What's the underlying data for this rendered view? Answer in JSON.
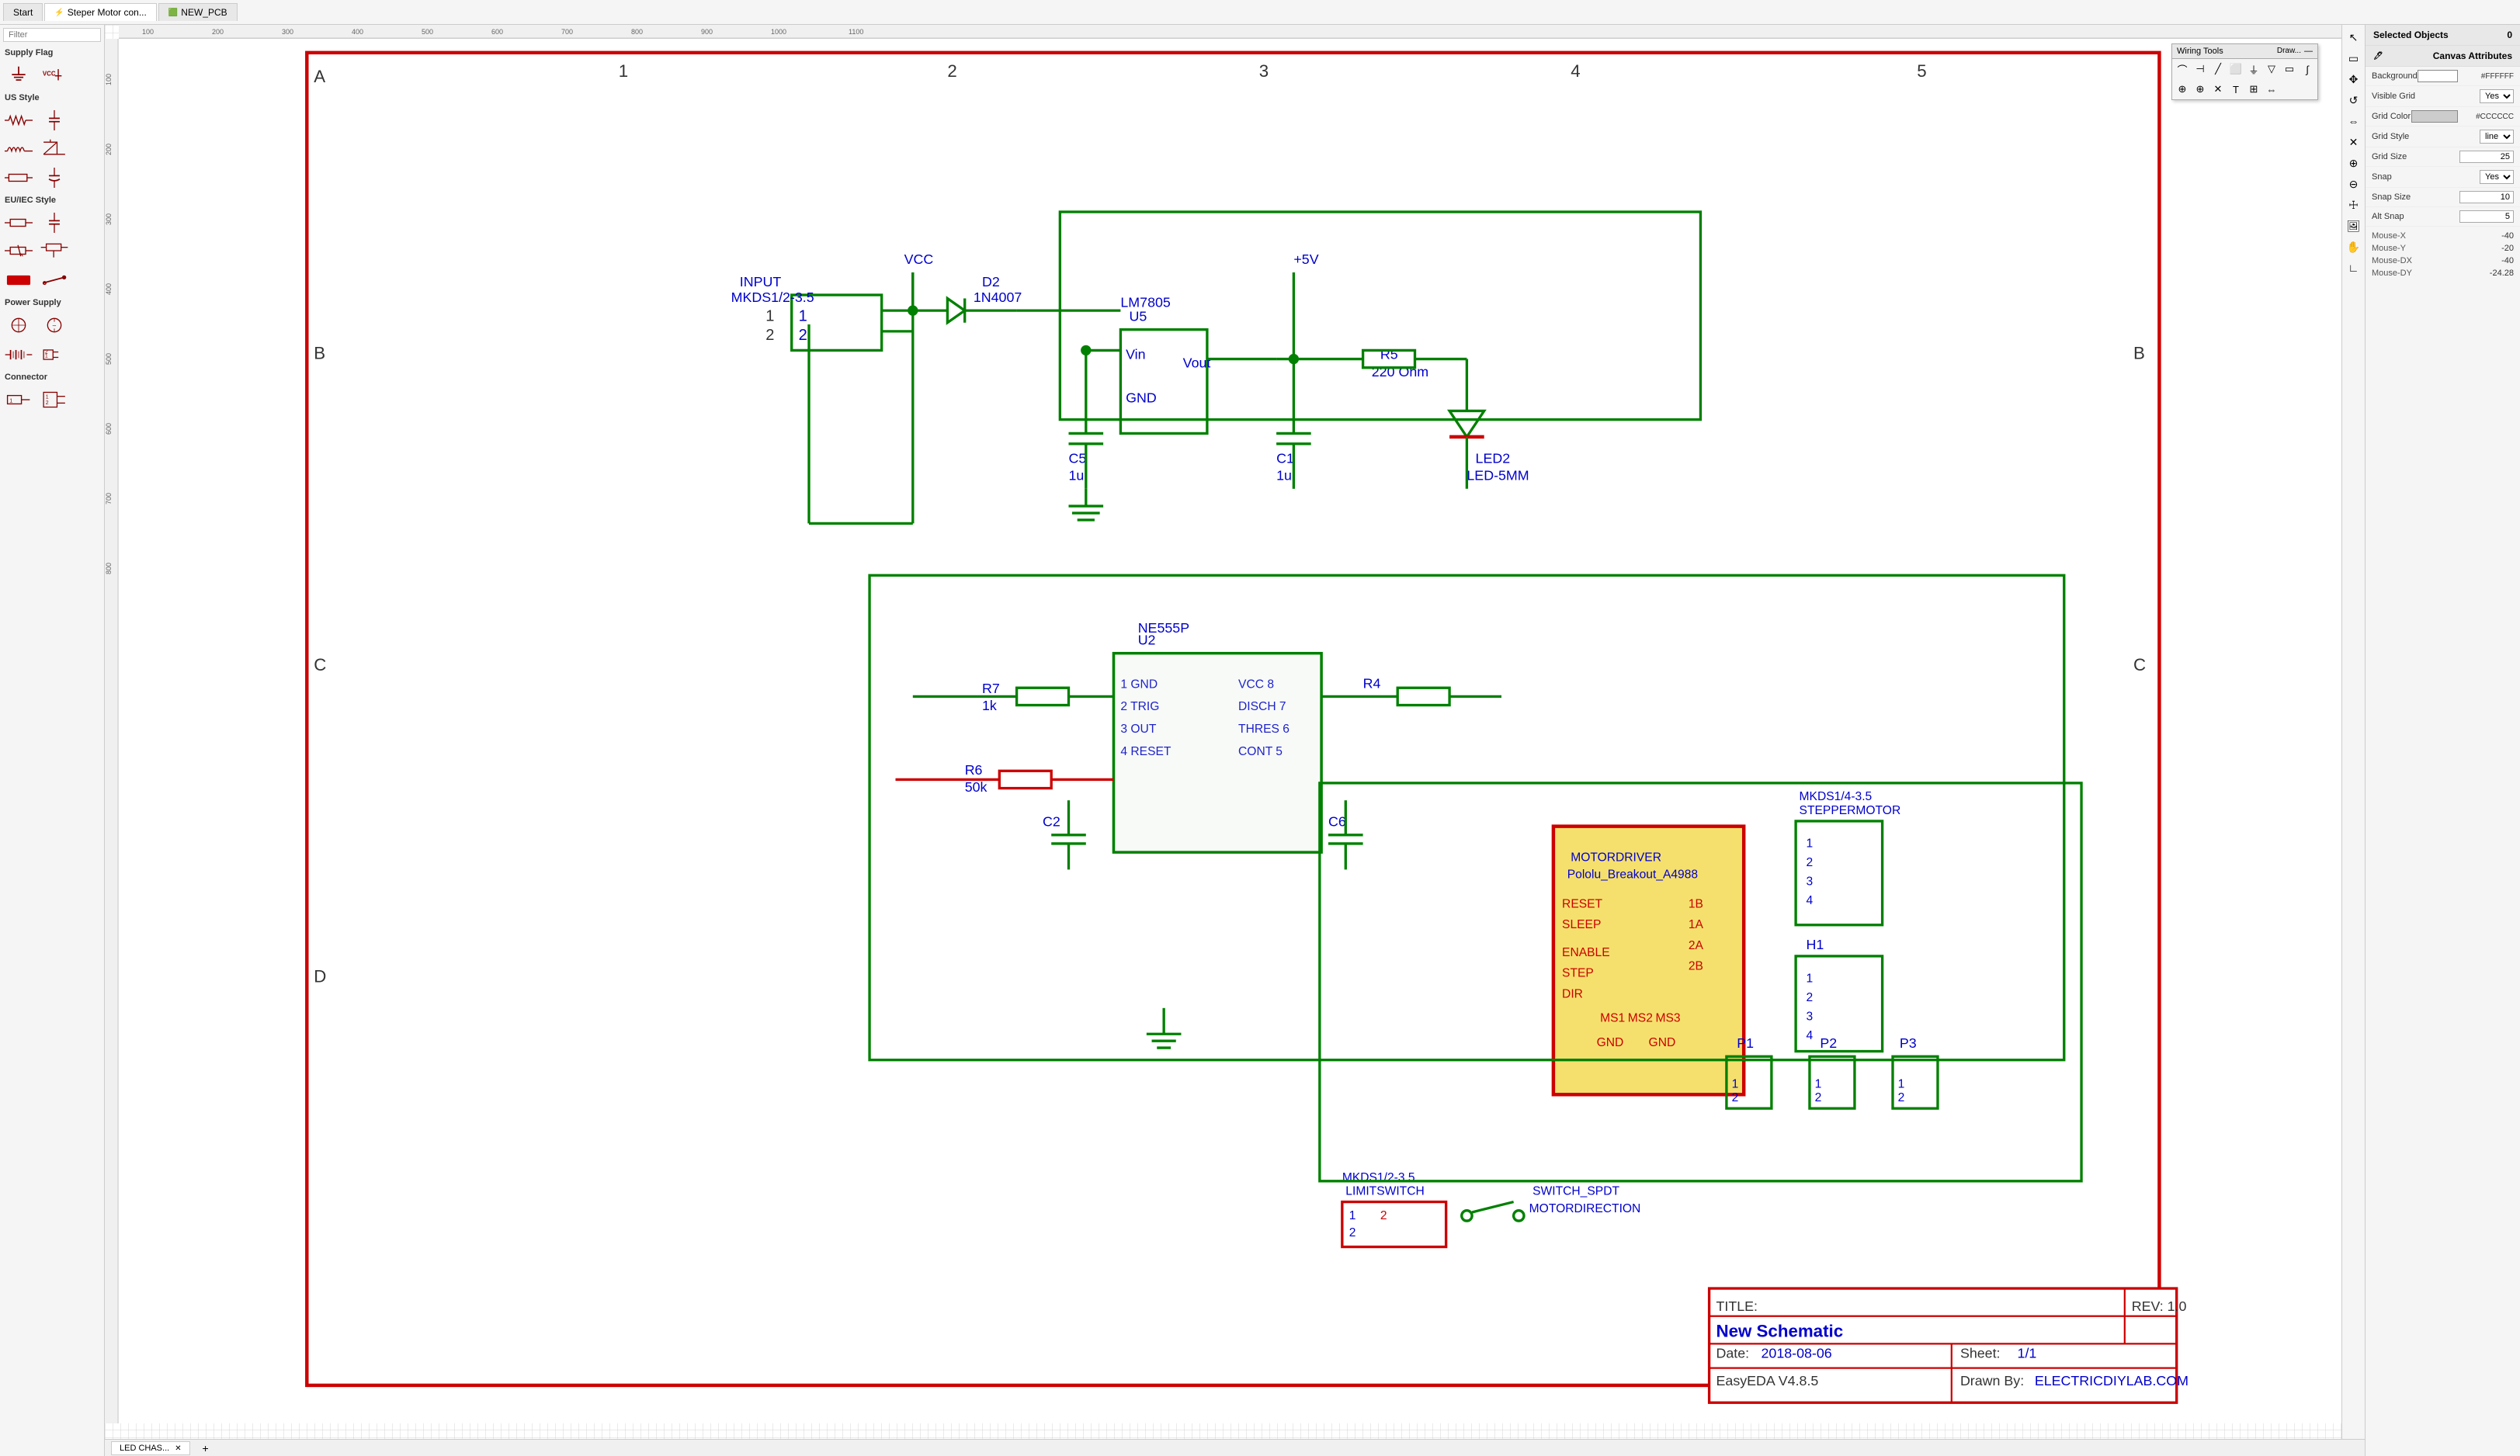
{
  "tabs": [
    {
      "id": "start",
      "label": "Start",
      "icon": "",
      "active": false
    },
    {
      "id": "stepper",
      "label": "Steper Motor con...",
      "icon": "⚡",
      "active": true
    },
    {
      "id": "pcb",
      "label": "NEW_PCB",
      "icon": "🟩",
      "active": false
    }
  ],
  "filter": {
    "placeholder": "Filter"
  },
  "sidebar": {
    "supply_flag_label": "Supply Flag",
    "us_style_label": "US Style",
    "eu_iec_label": "EU/IEC Style",
    "power_supply_label": "Power Supply",
    "connector_label": "Connector"
  },
  "wiring_toolbar": {
    "title": "Wiring Tools",
    "collapse_label": "Draw...",
    "minus_label": "—"
  },
  "right_panel": {
    "selected_objects_label": "Selected Objects",
    "selected_count": "0",
    "canvas_attributes_label": "Canvas Attributes",
    "background_label": "Background",
    "background_value": "#FFFFFF",
    "visible_grid_label": "Visible Grid",
    "visible_grid_value": "Yes",
    "grid_color_label": "Grid Color",
    "grid_color_value": "#CCCCCC",
    "grid_style_label": "Grid Style",
    "grid_style_value": "line",
    "grid_size_label": "Grid Size",
    "grid_size_value": "25",
    "snap_label": "Snap",
    "snap_value": "Yes",
    "snap_size_label": "Snap Size",
    "snap_size_value": "10",
    "alt_snap_label": "Alt Snap",
    "alt_snap_value": "5",
    "mouse_x_label": "Mouse-X",
    "mouse_x_value": "-40",
    "mouse_y_label": "Mouse-Y",
    "mouse_y_value": "-20",
    "mouse_dx_label": "Mouse-DX",
    "mouse_dx_value": "-40",
    "mouse_dy_label": "Mouse-DY",
    "mouse_dy_value": "-24.28"
  },
  "bottom_bar": {
    "tab_label": "LED CHAS...",
    "add_icon": "+"
  },
  "title_block": {
    "title_label": "TITLE:",
    "title_value": "New Schematic",
    "rev_label": "REV: 1.0",
    "date_label": "Date:",
    "date_value": "2018-08-06",
    "sheet_label": "Sheet:",
    "sheet_value": "1/1",
    "eda_label": "EasyEDA V4.8.5",
    "drawn_by_label": "Drawn By:",
    "drawn_by_value": "ELECTRICDIYLAB.COM"
  }
}
